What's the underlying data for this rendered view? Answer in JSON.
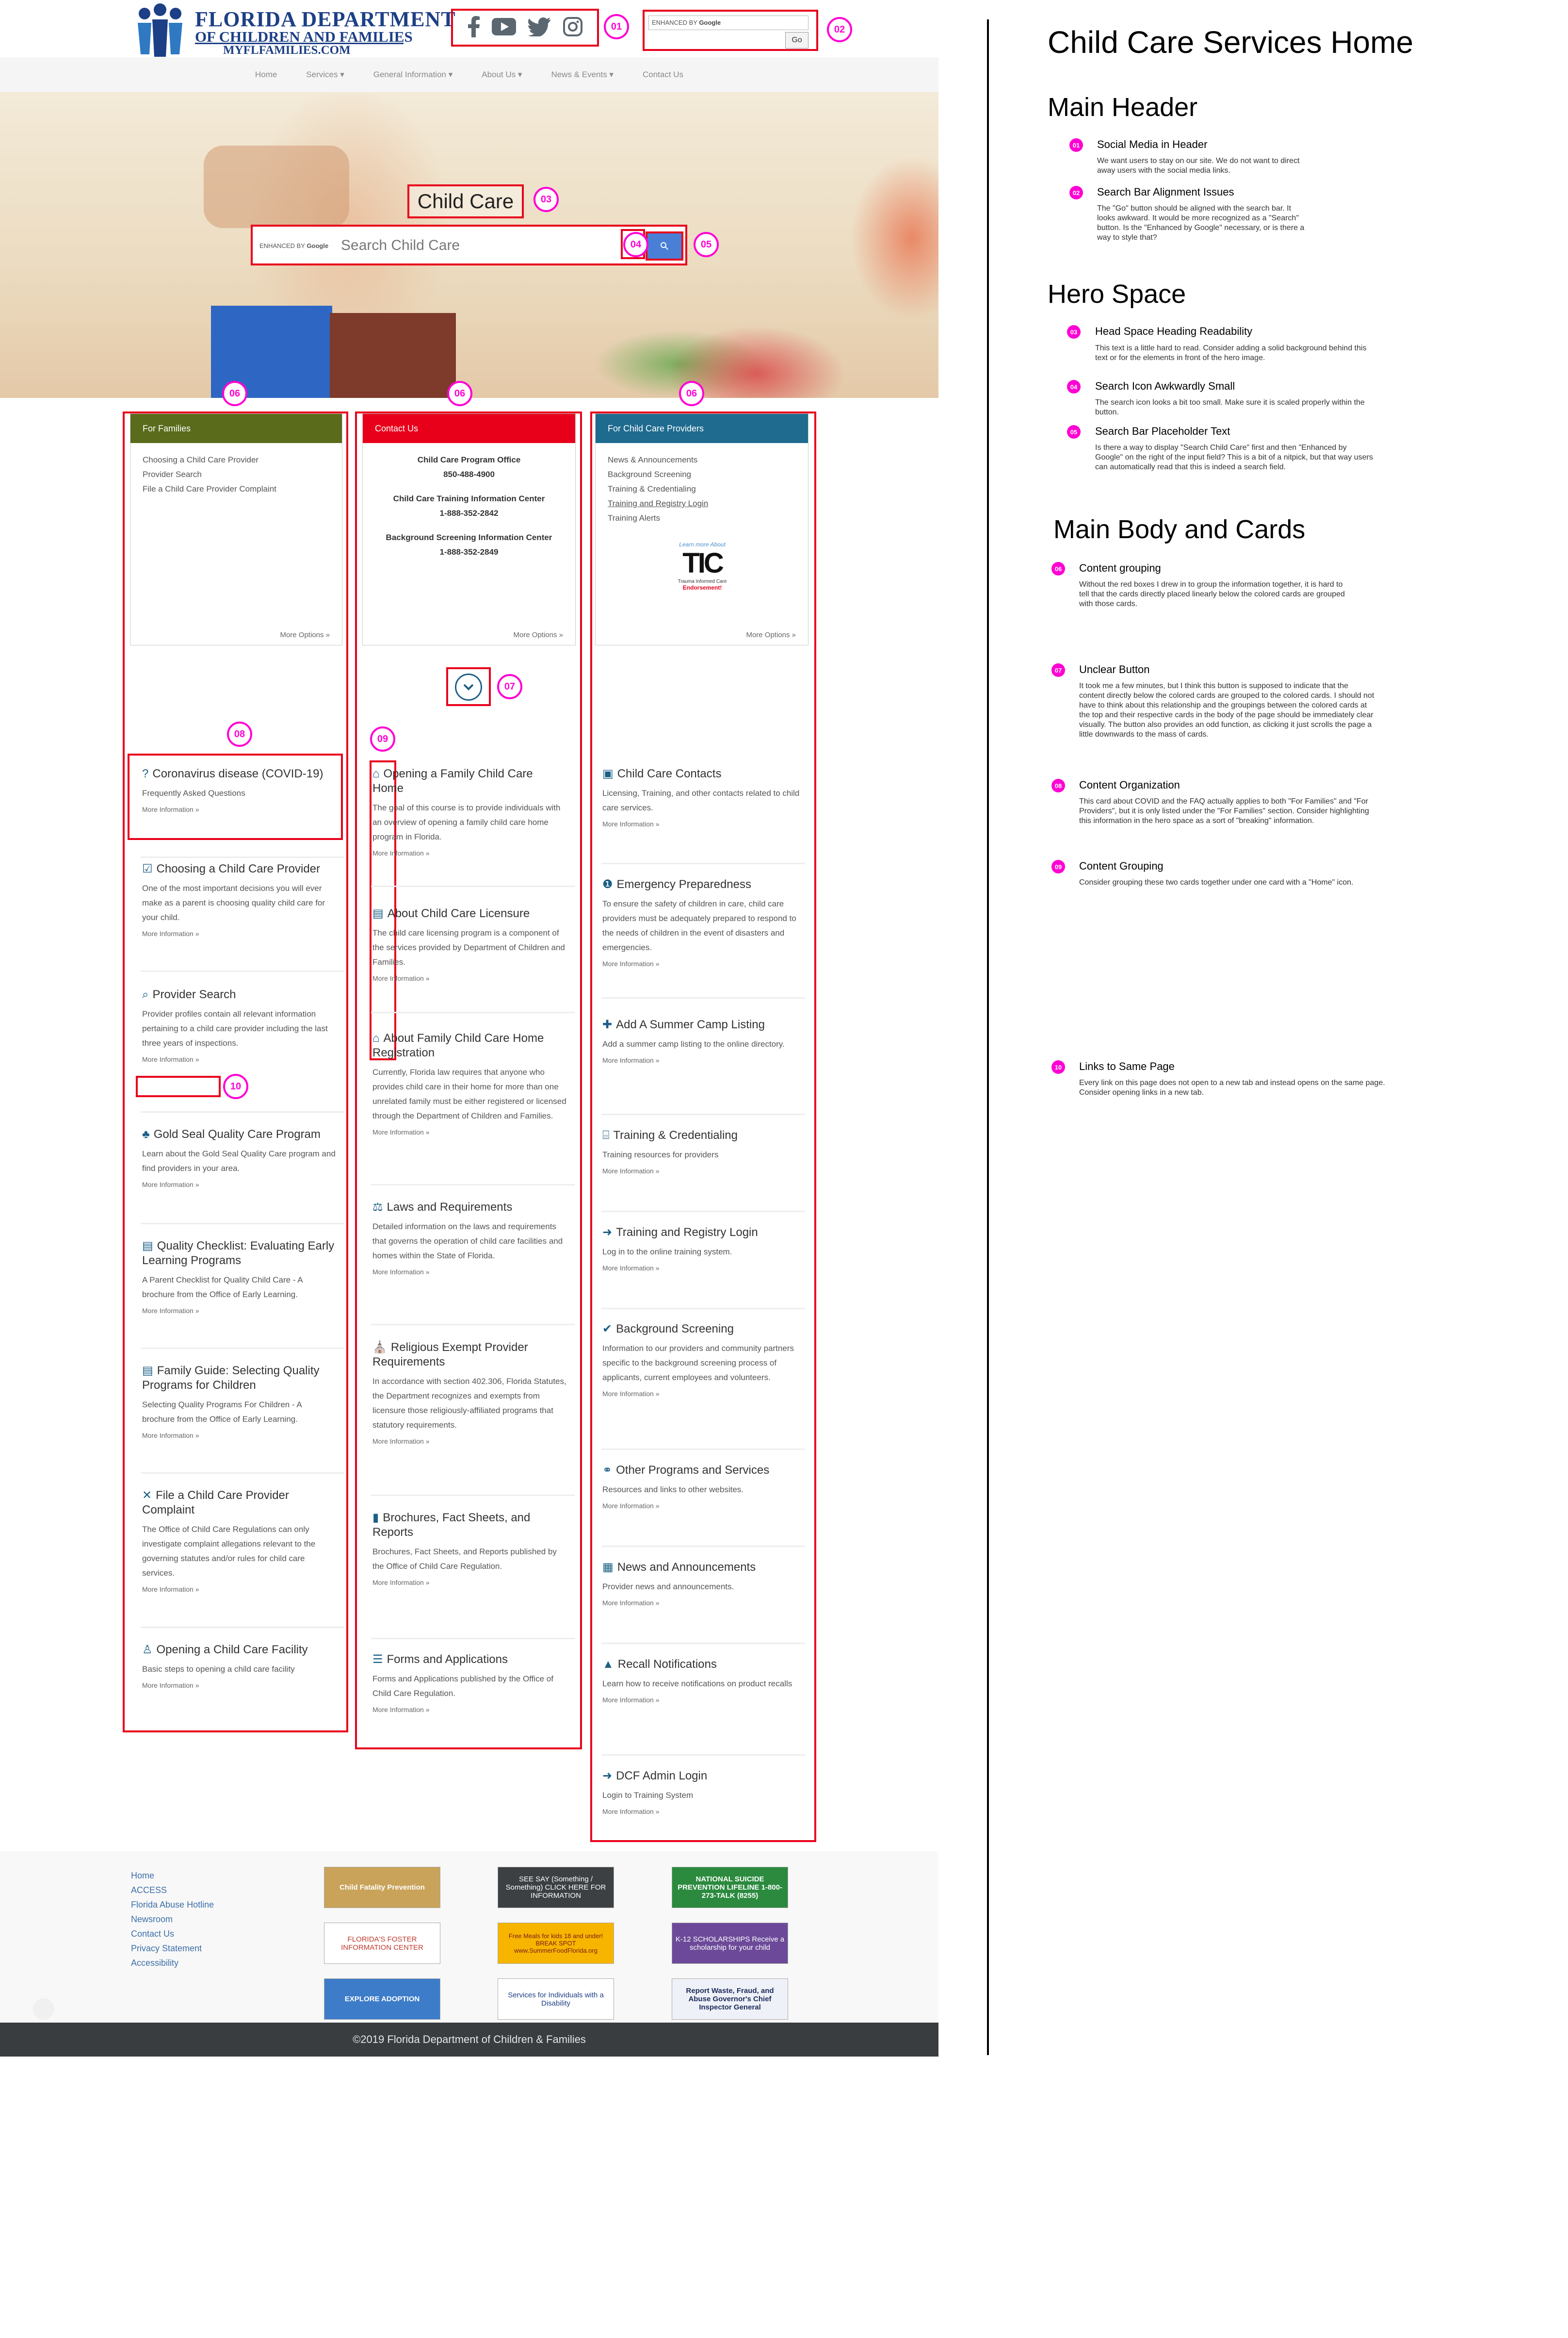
{
  "header": {
    "logo": {
      "line1": "FLORIDA DEPARTMENT",
      "line2": "OF CHILDREN AND FAMILIES",
      "line3": "MYFLFAMILIES.COM"
    },
    "social_icons": [
      "facebook-icon",
      "youtube-icon",
      "twitter-icon",
      "instagram-icon"
    ],
    "search": {
      "enhanced_label": "ENHANCED BY",
      "brand": "Google",
      "go_label": "Go"
    }
  },
  "markers": [
    "01",
    "02",
    "03",
    "04",
    "05",
    "06",
    "07",
    "08",
    "09",
    "10"
  ],
  "nav": {
    "items": [
      "Home",
      "Services ▾",
      "General Information ▾",
      "About Us ▾",
      "News & Events ▾",
      "Contact Us"
    ]
  },
  "hero": {
    "title": "Child Care",
    "search_enhanced": "ENHANCED BY",
    "search_brand": "Google",
    "search_placeholder": "Search Child Care",
    "search_icon": "search-icon"
  },
  "top_cards": {
    "families": {
      "header": "For Families",
      "items": [
        "Choosing a Child Care Provider",
        "Provider Search",
        "File a Child Care Provider Complaint"
      ],
      "more": "More Options »",
      "color": "#5a6b1b"
    },
    "contact": {
      "header": "Contact Us",
      "lines": [
        "Child Care Program Office",
        "850-488-4900",
        "Child Care Training Information Center",
        "1-888-352-2842",
        "Background Screening Information Center",
        "1-888-352-2849"
      ],
      "more": "More Options »",
      "color": "#e8001b"
    },
    "providers": {
      "header": "For Child Care Providers",
      "items": [
        "News & Announcements",
        "Background Screening",
        "Training & Credentialing",
        "Training and Registry Login",
        "Training Alerts"
      ],
      "tic_learn": "Learn more About",
      "tic_logo": "TIC",
      "tic_sub": "Trauma Informed Care",
      "tic_end": "Endorsement!",
      "more": "More Options »",
      "color": "#1e6b8f"
    }
  },
  "left_cards": [
    {
      "icon": "question-icon",
      "title": "Coronavirus disease (COVID-19)",
      "desc": "Frequently Asked Questions",
      "more": "More Information »"
    },
    {
      "icon": "checklist-icon",
      "title": "Choosing a Child Care Provider",
      "desc": "One of the most important decisions you will ever make as a parent is choosing quality child care for your child.",
      "more": "More Information »"
    },
    {
      "icon": "search-icon",
      "title": "Provider Search",
      "desc": "Provider profiles contain all relevant information pertaining to a child care provider including the last three years of inspections.",
      "more": "More Information »"
    },
    {
      "icon": "seal-icon",
      "title": "Gold Seal Quality Care Program",
      "desc": "Learn about the Gold Seal Quality Care program and find providers in your area.",
      "more": "More Information »"
    },
    {
      "icon": "document-icon",
      "title": "Quality Checklist: Evaluating Early Learning Programs",
      "desc": "A Parent Checklist for Quality Child Care - A brochure from the Office of Early Learning.",
      "more": "More Information »"
    },
    {
      "icon": "document-icon",
      "title": "Family Guide: Selecting Quality Programs for Children",
      "desc": "Selecting Quality Programs For Children - A brochure from the Office of Early Learning.",
      "more": "More Information »"
    },
    {
      "icon": "close-icon",
      "title": "File a Child Care Provider Complaint",
      "desc": "The Office of Child Care Regulations can only investigate complaint allegations relevant to the governing statutes and/or rules for child care services.",
      "more": "More Information »"
    },
    {
      "icon": "child-icon",
      "title": "Opening a Child Care Facility",
      "desc": "Basic steps to opening a child care facility",
      "more": "More Information »"
    }
  ],
  "middle_cards": [
    {
      "icon": "home-icon",
      "title": "Opening a Family Child Care Home",
      "desc": "The goal of this course is to provide individuals with an overview of opening a family child care home program in Florida.",
      "more": "More Information »"
    },
    {
      "icon": "document-icon",
      "title": "About Child Care Licensure",
      "desc": "The child care licensing program is a component of the services provided by Department of Children and Families.",
      "more": "More Information »"
    },
    {
      "icon": "home-icon",
      "title": "About Family Child Care Home Registration",
      "desc": "Currently, Florida law requires that anyone who provides child care in their home for more than one unrelated family must be either registered or licensed through the Department of Children and Families.",
      "more": "More Information »"
    },
    {
      "icon": "scale-icon",
      "title": "Laws and Requirements",
      "desc": "Detailed information on the laws and requirements that governs the operation of child care facilities and homes within the State of Florida.",
      "more": "More Information »"
    },
    {
      "icon": "building-icon",
      "title": "Religious Exempt Provider Requirements",
      "desc": "In accordance with section 402.306, Florida Statutes, the Department recognizes and exempts from licensure those religiously-affiliated programs that statutory requirements.",
      "more": "More Information »"
    },
    {
      "icon": "book-icon",
      "title": "Brochures, Fact Sheets, and Reports",
      "desc": "Brochures, Fact Sheets, and Reports published by the Office of Child Care Regulation.",
      "more": "More Information »"
    },
    {
      "icon": "form-icon",
      "title": "Forms and Applications",
      "desc": "Forms and Applications published by the Office of Child Care Regulation.",
      "more": "More Information »"
    }
  ],
  "right_cards": [
    {
      "icon": "contact-icon",
      "title": "Child Care Contacts",
      "desc": "Licensing, Training, and other contacts related to child care services.",
      "more": "More Information »"
    },
    {
      "icon": "alert-icon",
      "title": "Emergency Preparedness",
      "desc": "To ensure the safety of children in care, child care providers must be adequately prepared to respond to the needs of children in the event of disasters and emergencies.",
      "more": "More Information »"
    },
    {
      "icon": "add-user-icon",
      "title": "Add A Summer Camp Listing",
      "desc": "Add a summer camp listing to the online directory.",
      "more": "More Information »"
    },
    {
      "icon": "columns-icon",
      "title": "Training & Credentialing",
      "desc": "Training resources for providers",
      "more": "More Information »"
    },
    {
      "icon": "login-icon",
      "title": "Training and Registry Login",
      "desc": "Log in to the online training system.",
      "more": "More Information »"
    },
    {
      "icon": "user-check-icon",
      "title": "Background Screening",
      "desc": "Information to our providers and community partners specific to the background screening process of applicants, current employees and volunteers.",
      "more": "More Information »"
    },
    {
      "icon": "link-icon",
      "title": "Other Programs and Services",
      "desc": "Resources and links to other websites.",
      "more": "More Information »"
    },
    {
      "icon": "newspaper-icon",
      "title": "News and Announcements",
      "desc": "Provider news and announcements.",
      "more": "More Information »"
    },
    {
      "icon": "warning-icon",
      "title": "Recall Notifications",
      "desc": "Learn how to receive notifications on product recalls",
      "more": "More Information »"
    },
    {
      "icon": "login-icon",
      "title": "DCF Admin Login",
      "desc": "Login to Training System",
      "more": "More Information »"
    }
  ],
  "scroll_button_icon": "chevron-down-icon",
  "footer": {
    "links": [
      "Home",
      "ACCESS",
      "Florida Abuse Hotline",
      "Newsroom",
      "Contact Us",
      "Privacy Statement",
      "Accessibility"
    ],
    "ads": [
      "Child Fatality Prevention",
      "SEE SAY (Something / Something) CLICK HERE FOR INFORMATION",
      "NATIONAL SUICIDE PREVENTION LIFELINE 1-800-273-TALK (8255)",
      "FLORIDA'S FOSTER INFORMATION CENTER",
      "Free Meals for kids 18 and under! BREAK SPOT www.SummerFoodFlorida.org",
      "K-12 SCHOLARSHIPS Receive a scholarship for your child",
      "EXPLORE ADOPTION",
      "Services for Individuals with a Disability",
      "Report Waste, Fraud, and Abuse Governor's Chief Inspector General"
    ],
    "copyright": "©2019 Florida Department of Children & Families"
  },
  "annotations": {
    "title": "Child Care Services Home",
    "sections": [
      {
        "heading": "Main Header",
        "items": [
          {
            "num": "01",
            "title": "Social Media in Header",
            "text": "We want users to stay on our site. We do not want to direct away users with the social media links."
          },
          {
            "num": "02",
            "title": "Search Bar Alignment Issues",
            "text": "The \"Go\" button should be aligned with the search bar. It looks awkward. It would be more recognized as a \"Search\" button. Is the \"Enhanced by Google\" necessary, or is there a way to style that?"
          }
        ]
      },
      {
        "heading": "Hero Space",
        "items": [
          {
            "num": "03",
            "title": "Head Space Heading Readability",
            "text": "This text is a little hard to read. Consider adding a solid background behind this text or for the elements in front of the hero image."
          },
          {
            "num": "04",
            "title": "Search Icon Awkwardly Small",
            "text": "The search icon looks a bit too small. Make sure it is scaled properly within the button."
          },
          {
            "num": "05",
            "title": "Search Bar Placeholder Text",
            "text": "Is there a way to display \"Search Child Care\" first and then \"Enhanced by Google\" on the right of the input field? This is a bit of a nitpick, but that way users can automatically read that this is indeed a search field."
          }
        ]
      },
      {
        "heading": "Main Body and Cards",
        "items": [
          {
            "num": "06",
            "title": "Content grouping",
            "text": "Without the red boxes I drew in to group the information together, it is hard to tell that the cards directly placed linearly below the colored cards are grouped with those cards."
          },
          {
            "num": "07",
            "title": "Unclear Button",
            "text": "It took me a few minutes, but I think this button is supposed to indicate that the content directly below the colored cards are grouped to the colored cards. I should not have to think about this relationship and the groupings between the colored cards at the top and their respective cards in the body of the page should be immediately clear visually. The button also provides an odd function, as clicking it just scrolls the page a little downwards to the mass of cards."
          },
          {
            "num": "08",
            "title": "Content Organization",
            "text": "This card about COVID and the FAQ actually applies to both \"For Families\" and \"For Providers\", but it is only listed under the \"For Families\" section. Consider highlighting this information in the hero space as a sort of \"breaking\" information."
          },
          {
            "num": "09",
            "title": "Content Grouping",
            "text": "Consider grouping these two cards together under one card with a \"Home\" icon."
          },
          {
            "num": "10",
            "title": "Links to Same Page",
            "text": "Every link on this page does not open to a new tab and instead opens on the same page. Consider opening links in a new tab."
          }
        ]
      }
    ]
  }
}
